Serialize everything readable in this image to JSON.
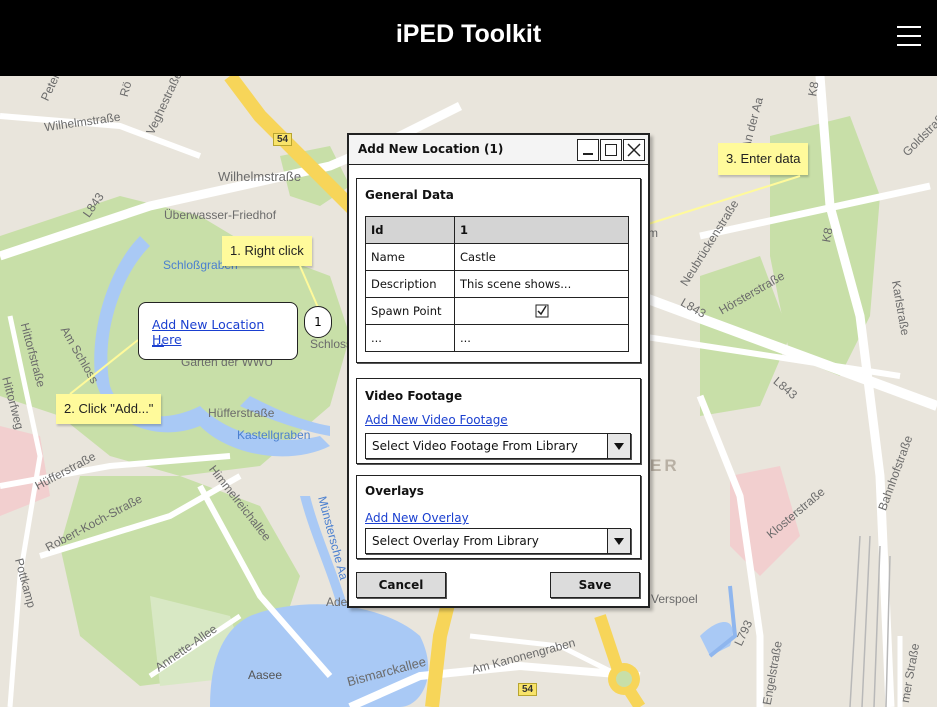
{
  "app": {
    "title": "iPED Toolkit"
  },
  "map": {
    "labels": {
      "wilhelmstrasse_top": "Wilhelmstraße",
      "wilhelmstrasse": "Wilhelmstraße",
      "friedhof": "Überwasser-Friedhof",
      "l843_left": "L843",
      "schlossgraben": "Schloßgraben",
      "garten": "Garten der WWU",
      "schloss": "Schloss",
      "hittorfstrasse": "Hittorfstraße",
      "am_schloss": "Am Schloss",
      "huefferstrasse_mid": "Hüfferstraße",
      "kastellgraben": "Kastellgraben",
      "huefferstrasse_left": "Hüfferstraße",
      "himmelreichallee": "Himmelreichallee",
      "robert_koch": "Robert-Koch-Straße",
      "potts": "Pottkamp",
      "muenstersche_aa": "Münstersche Aa",
      "annette": "Annette-Allee",
      "aasee": "Aasee",
      "bismarckallee": "Bismarckallee",
      "am_kanonengraben": "Am Kanonengraben",
      "neubrueckenstrasse": "Neubrückenstraße",
      "hoersterstrasse": "Hörsterstraße",
      "l843_mid": "L843",
      "l843_right": "L843",
      "k8_top": "K8",
      "k8": "K8",
      "karlstrasse": "Karlstraße",
      "goldstrasse": "Goldstraße",
      "klosterstrasse": "Klosterstraße",
      "bahnhofstrasse": "Bahnhofstraße",
      "l793": "L793",
      "engelstrasse": "Engelstraße",
      "am_strasse": "mer Straße",
      "vers_pool": "Verspoel",
      "fragment_er": "ER",
      "fragment_m": "m",
      "fragment_ade": "Ade",
      "fragment_peter": "Peter",
      "fragment_ro": "Rö",
      "fragment_veghe": "Veghestraße",
      "fragment_aa": "An der Aa",
      "fragment_hittorf": "Hittorfweg"
    },
    "road_badges": [
      "54",
      "54"
    ],
    "colors": {
      "park": "#c8dfa8",
      "water": "#a9c9f5",
      "road_major": "#f7d559",
      "road": "#ffffff"
    }
  },
  "annotations": {
    "step1": "1. Right click",
    "step2": "2. Click \"Add...\"",
    "step3": "3. Enter data",
    "callout_number": "1"
  },
  "context_menu": {
    "item_label": "Add New Location Here",
    "more_label": "..."
  },
  "dialog": {
    "title": "Add New Location (1)",
    "general": {
      "title": "General Data",
      "header": [
        "Id",
        "1"
      ],
      "rows": [
        {
          "label": "Name",
          "value": "Castle"
        },
        {
          "label": "Description",
          "value": "This scene shows..."
        },
        {
          "label": "Spawn Point",
          "value": ""
        },
        {
          "label": "...",
          "value": "..."
        }
      ],
      "spawn_point_checked": true
    },
    "video": {
      "title": "Video Footage",
      "link": "Add New Video Footage",
      "select": "Select Video Footage From Library"
    },
    "overlays": {
      "title": "Overlays",
      "link": "Add New Overlay",
      "select": "Select Overlay From Library"
    },
    "cancel_label": "Cancel",
    "save_label": "Save"
  }
}
